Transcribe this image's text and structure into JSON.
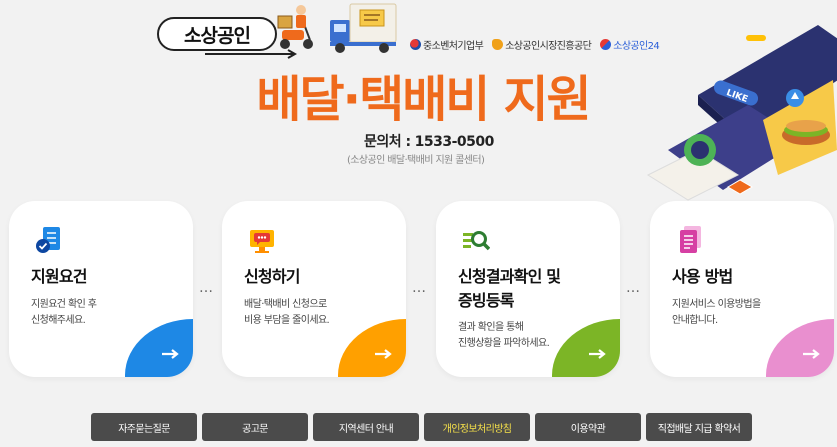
{
  "header": {
    "brand_label": "소상공인",
    "logos": [
      {
        "label": "중소벤처기업부",
        "icon": "mss-emblem-icon",
        "color": "#1f4fa8"
      },
      {
        "label": "소상공인시장진흥공단",
        "icon": "semas-logo-icon",
        "color": "#f0a11a"
      },
      {
        "label": "소상공인24",
        "icon": "sbiz24-logo-icon",
        "color": "#2b5fd8"
      }
    ],
    "title": "배달·택배비 지원",
    "contact_label": "문의처 :",
    "contact_phone": "1533-0500",
    "contact_sub": "(소상공인 배달·택배비 지원 콜센터)"
  },
  "cards": [
    {
      "title": "지원요건",
      "desc_lines": [
        "지원요건 확인 후",
        "신청해주세요."
      ],
      "icon": "document-check-icon",
      "accent": "#1e88e5"
    },
    {
      "title": "신청하기",
      "desc_lines": [
        "배달·택배비 신청으로",
        "비용 부담을 줄이세요."
      ],
      "icon": "monitor-chat-icon",
      "accent": "#ffa000"
    },
    {
      "title": "신청결과확인 및 증빙등록",
      "title_lines": [
        "신청결과확인 및",
        "증빙등록"
      ],
      "desc_lines": [
        "결과 확인을 통해",
        "진행상황을 파악하세요."
      ],
      "icon": "magnifier-list-icon",
      "accent": "#7cb526"
    },
    {
      "title": "사용 방법",
      "desc_lines": [
        "지원서비스 이용방법을",
        "안내합니다."
      ],
      "icon": "pink-document-icon",
      "accent": "#e98fcf"
    }
  ],
  "separator": "…",
  "footer_buttons": [
    {
      "label": "자주묻는질문",
      "highlight": false
    },
    {
      "label": "공고문",
      "highlight": false
    },
    {
      "label": "지역센터 안내",
      "highlight": false
    },
    {
      "label": "개인정보처리방침",
      "highlight": true
    },
    {
      "label": "이용약관",
      "highlight": false
    },
    {
      "label": "직접배달 지급 확약서",
      "highlight": false
    }
  ],
  "illustration": {
    "like_badge": "LIKE"
  }
}
